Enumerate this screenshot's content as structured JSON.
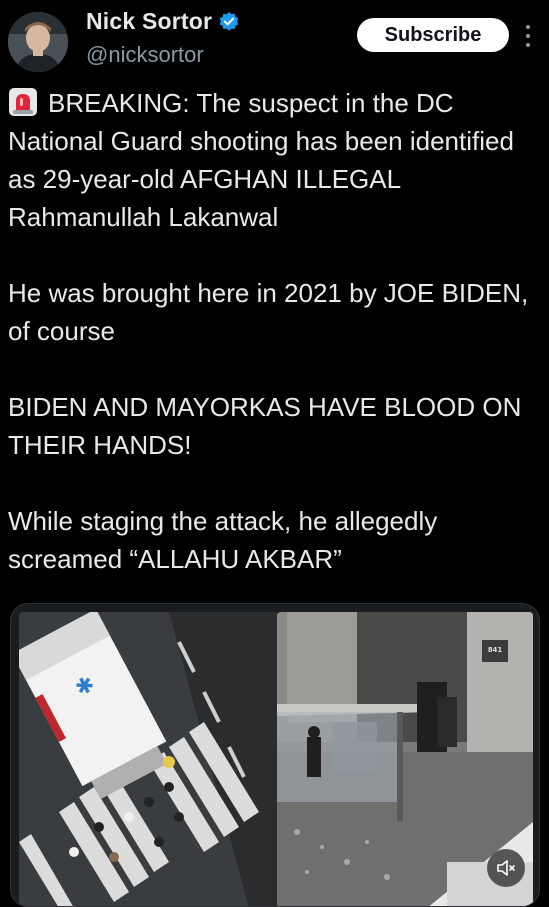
{
  "author": {
    "display_name": "Nick Sortor",
    "handle": "@nicksortor",
    "verified_icon": "verified-badge-icon",
    "verified_color": "#1d9bf0"
  },
  "header": {
    "subscribe_label": "Subscribe",
    "more_icon": "more-vertical-icon"
  },
  "tweet": {
    "emoji_icon": "police-siren-icon",
    "paragraphs": [
      "BREAKING: The suspect in the DC National Guard shooting has been identified as 29-year-old AFGHAN ILLEGAL Rahmanullah Lakanwal",
      "He was brought here in 2021 by JOE BIDEN, of course",
      "BIDEN AND MAYORKAS HAVE BLOOD ON THEIR HANDS!",
      "While staging the attack, he allegedly screamed “ALLAHU AKBAR”"
    ]
  },
  "media": {
    "building_number": "841",
    "mute_icon": "volume-muted-icon"
  },
  "colors": {
    "background": "#000000",
    "text": "#e7e9ea",
    "secondary_text": "#8b98a5",
    "subscribe_bg": "#ffffff"
  }
}
